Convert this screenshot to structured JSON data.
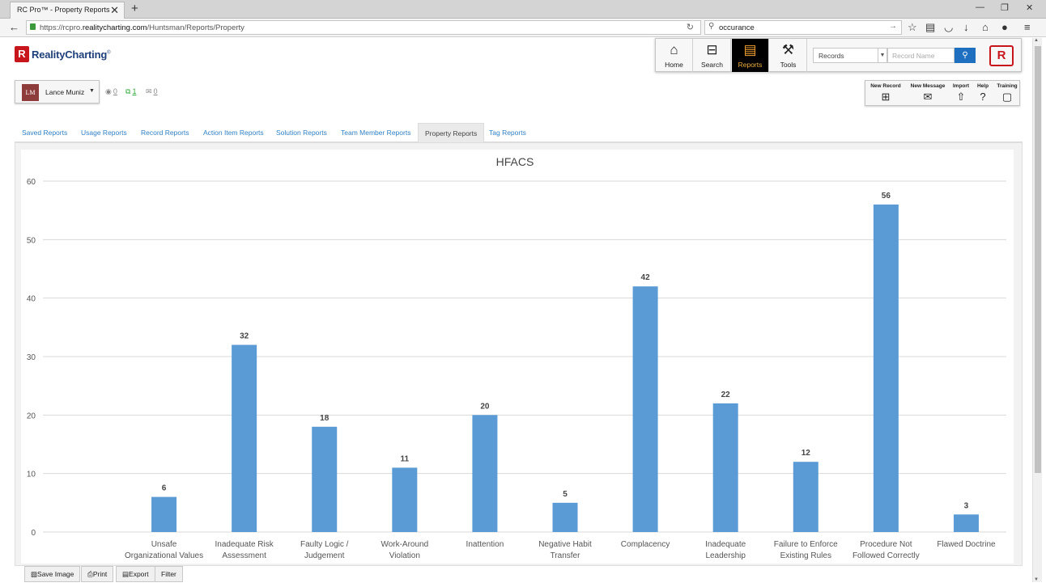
{
  "browser": {
    "tab_title": "RC Pro™ - Property Reports",
    "url_prefix": "https://rcpro.",
    "url_domain": "realitycharting.com",
    "url_path": "/Huntsman/Reports/Property",
    "search_text": "occurance"
  },
  "app": {
    "logo_text": "RealityCharting",
    "logo_mark": "®",
    "nav": [
      {
        "label": "Home",
        "icon": "home-icon"
      },
      {
        "label": "Search",
        "icon": "search-diagram-icon"
      },
      {
        "label": "Reports",
        "icon": "reports-icon",
        "active": true
      },
      {
        "label": "Tools",
        "icon": "tools-icon"
      }
    ],
    "records_select": "Records",
    "record_name_placeholder": "Record Name"
  },
  "user": {
    "initials": "LM",
    "name": "Lance Muniz",
    "stat_a": "0",
    "stat_b": "1",
    "stat_c": "0"
  },
  "actions": [
    {
      "label": "New Record",
      "icon": "new-record-icon"
    },
    {
      "label": "New Message",
      "icon": "new-message-icon"
    },
    {
      "label": "Import",
      "icon": "import-icon"
    },
    {
      "label": "Help",
      "icon": "help-icon"
    },
    {
      "label": "Training",
      "icon": "training-book-icon"
    }
  ],
  "report_tabs": [
    {
      "label": "Saved Reports"
    },
    {
      "label": "Usage Reports"
    },
    {
      "label": "Record Reports"
    },
    {
      "label": "Action Item Reports"
    },
    {
      "label": "Solution Reports"
    },
    {
      "label": "Team Member Reports"
    },
    {
      "label": "Property Reports",
      "active": true
    },
    {
      "label": "Tag Reports"
    }
  ],
  "chart_data": {
    "type": "bar",
    "title": "HFACS",
    "xlabel": "",
    "ylabel": "",
    "ylim": [
      0,
      60
    ],
    "yticks": [
      0,
      10,
      20,
      30,
      40,
      50,
      60
    ],
    "grid": true,
    "color": "#5b9bd5",
    "categories": [
      [
        "Unsafe",
        "Organizational Values"
      ],
      [
        "Inadequate Risk",
        "Assessment"
      ],
      [
        "Faulty Logic /",
        "Judgement"
      ],
      [
        "Work-Around",
        "Violation"
      ],
      [
        "Inattention"
      ],
      [
        "Negative Habit",
        "Transfer"
      ],
      [
        "Complacency"
      ],
      [
        "Inadequate",
        "Leadership"
      ],
      [
        "Failure to Enforce",
        "Existing Rules"
      ],
      [
        "Procedure Not",
        "Followed Correctly"
      ],
      [
        "Flawed Doctrine"
      ]
    ],
    "values": [
      6,
      32,
      18,
      11,
      20,
      5,
      42,
      22,
      12,
      56,
      3
    ]
  },
  "bottom_buttons": [
    {
      "label": "Save Image",
      "icon": "image-icon"
    },
    {
      "label": "Print",
      "icon": "printer-icon"
    },
    {
      "label": "Export",
      "icon": "export-file-icon"
    },
    {
      "label": "Filter"
    }
  ]
}
